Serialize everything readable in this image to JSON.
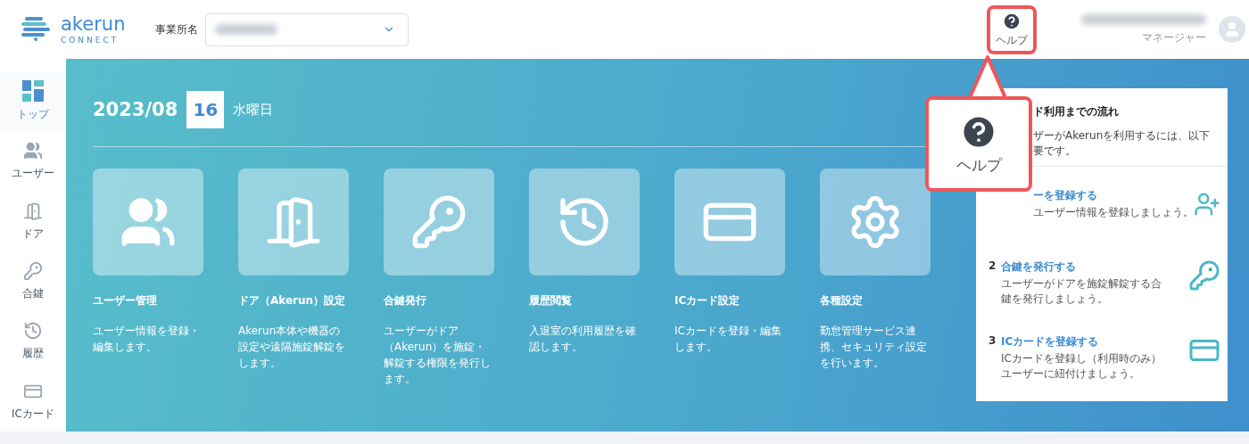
{
  "header": {
    "logo": {
      "name": "akerun",
      "sub": "CONNECT"
    },
    "office_label": "事業所名",
    "help_label": "ヘルプ",
    "help_highlighted": true,
    "user_role": "マネージャー"
  },
  "sidebar": {
    "items": [
      {
        "kind": "top",
        "label": "トップ",
        "selected": true
      },
      {
        "kind": "users",
        "label": "ユーザー",
        "selected": false
      },
      {
        "kind": "door",
        "label": "ドア",
        "selected": false
      },
      {
        "kind": "key",
        "label": "合鍵",
        "selected": false
      },
      {
        "kind": "history",
        "label": "履歴",
        "selected": false
      },
      {
        "kind": "card",
        "label": "ICカード",
        "selected": false
      }
    ]
  },
  "date": {
    "month": "2023/08",
    "day": "16",
    "weekday": "水曜日"
  },
  "menu_tiles": [
    {
      "kind": "users",
      "title": "ユーザー管理",
      "lines": [
        "ユーザー情報を登録・",
        "編集します。"
      ]
    },
    {
      "kind": "door",
      "title": "ドア（Akerun）設定",
      "lines": [
        "Akerun本体や機器の",
        "設定や遠隔施錠解錠を",
        "します。"
      ]
    },
    {
      "kind": "key",
      "title": "合鍵発行",
      "lines": [
        "ユーザーがドア",
        "（Akerun）を施錠・",
        "解錠する権限を発行し",
        "ます。"
      ]
    },
    {
      "kind": "history",
      "title": "履歴閲覧",
      "lines": [
        "入退室の利用履歴を確",
        "認します。"
      ]
    },
    {
      "kind": "card",
      "title": "ICカード設定",
      "lines": [
        "ICカードを登録・編集",
        "します。"
      ]
    },
    {
      "kind": "settings",
      "title": "各種設定",
      "lines": [
        "勤怠管理サービス連",
        "携、セキュリティ設定",
        "を行います。"
      ]
    }
  ],
  "guide": {
    "title": "ド利用までの流れ",
    "intro": [
      "ザーがAkerunを利用するには、以下",
      "要です。"
    ],
    "steps": [
      {
        "kind": "user",
        "title": "ーを登録する",
        "lines": [
          "ユーザー情報を登録しましょう。"
        ]
      },
      {
        "kind": "key",
        "number": "2",
        "title": "合鍵を発行する",
        "lines": [
          "ユーザーがドアを施錠解錠する合",
          "鍵を発行しましょう。"
        ]
      },
      {
        "kind": "card",
        "number": "3",
        "title": "ICカードを登録する",
        "lines": [
          "ICカードを登録し（利用時のみ）",
          "ユーザーに紐付けましょう。"
        ]
      }
    ]
  },
  "callout": {
    "label": "ヘルプ"
  }
}
